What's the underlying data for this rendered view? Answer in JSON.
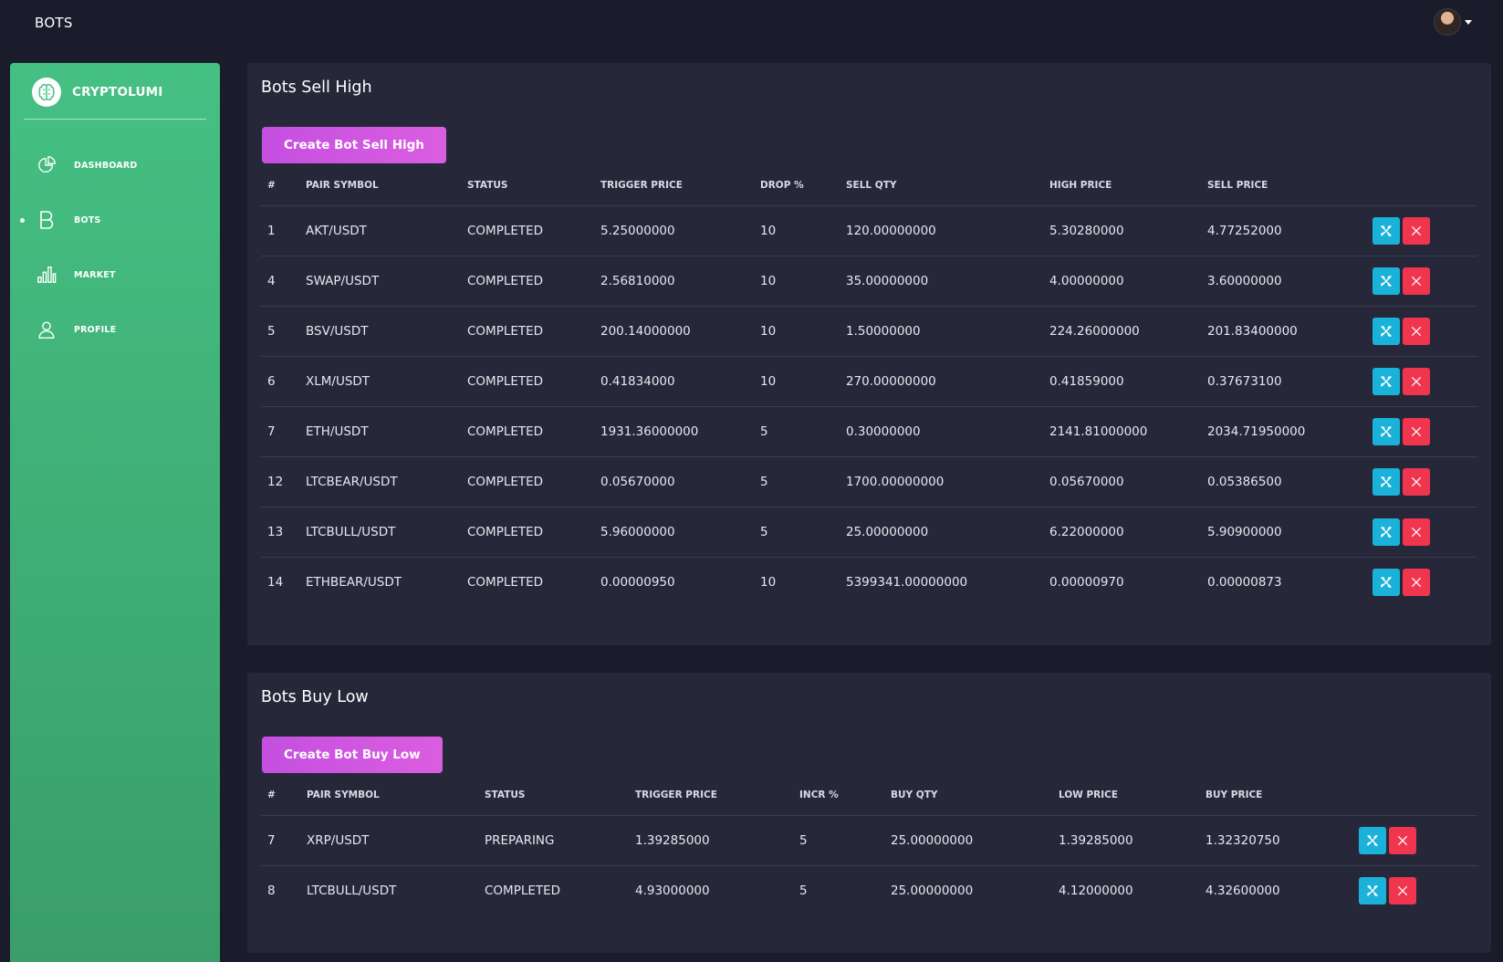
{
  "topbar": {
    "title": "BOTS"
  },
  "brand": {
    "name": "CRYPTOLUMI"
  },
  "nav": [
    {
      "label": "DASHBOARD",
      "icon": "pie-chart-icon",
      "active": false
    },
    {
      "label": "BOTS",
      "icon": "bitcoin-b-icon",
      "active": true
    },
    {
      "label": "MARKET",
      "icon": "bar-chart-icon",
      "active": false
    },
    {
      "label": "PROFILE",
      "icon": "user-icon",
      "active": false
    }
  ],
  "colors": {
    "sidebar": "#45c083",
    "create_button": "#c44fe0",
    "edit_button": "#1bb2d9",
    "delete_button": "#f0354f",
    "card": "#262839",
    "background": "#1b1c2b"
  },
  "sell": {
    "title": "Bots Sell High",
    "create_label": "Create Bot Sell High",
    "columns": [
      "#",
      "PAIR SYMBOL",
      "STATUS",
      "TRIGGER PRICE",
      "DROP %",
      "SELL QTY",
      "HIGH PRICE",
      "SELL PRICE"
    ],
    "rows": [
      [
        "1",
        "AKT/USDT",
        "COMPLETED",
        "5.25000000",
        "10",
        "120.00000000",
        "5.30280000",
        "4.77252000"
      ],
      [
        "4",
        "SWAP/USDT",
        "COMPLETED",
        "2.56810000",
        "10",
        "35.00000000",
        "4.00000000",
        "3.60000000"
      ],
      [
        "5",
        "BSV/USDT",
        "COMPLETED",
        "200.14000000",
        "10",
        "1.50000000",
        "224.26000000",
        "201.83400000"
      ],
      [
        "6",
        "XLM/USDT",
        "COMPLETED",
        "0.41834000",
        "10",
        "270.00000000",
        "0.41859000",
        "0.37673100"
      ],
      [
        "7",
        "ETH/USDT",
        "COMPLETED",
        "1931.36000000",
        "5",
        "0.30000000",
        "2141.81000000",
        "2034.71950000"
      ],
      [
        "12",
        "LTCBEAR/USDT",
        "COMPLETED",
        "0.05670000",
        "5",
        "1700.00000000",
        "0.05670000",
        "0.05386500"
      ],
      [
        "13",
        "LTCBULL/USDT",
        "COMPLETED",
        "5.96000000",
        "5",
        "25.00000000",
        "6.22000000",
        "5.90900000"
      ],
      [
        "14",
        "ETHBEAR/USDT",
        "COMPLETED",
        "0.00000950",
        "10",
        "5399341.00000000",
        "0.00000970",
        "0.00000873"
      ]
    ]
  },
  "buy": {
    "title": "Bots Buy Low",
    "create_label": "Create Bot Buy Low",
    "columns": [
      "#",
      "PAIR SYMBOL",
      "STATUS",
      "TRIGGER PRICE",
      "INCR %",
      "BUY QTY",
      "LOW PRICE",
      "BUY PRICE"
    ],
    "rows": [
      [
        "7",
        "XRP/USDT",
        "PREPARING",
        "1.39285000",
        "5",
        "25.00000000",
        "1.39285000",
        "1.32320750"
      ],
      [
        "8",
        "LTCBULL/USDT",
        "COMPLETED",
        "4.93000000",
        "5",
        "25.00000000",
        "4.12000000",
        "4.32600000"
      ]
    ]
  }
}
